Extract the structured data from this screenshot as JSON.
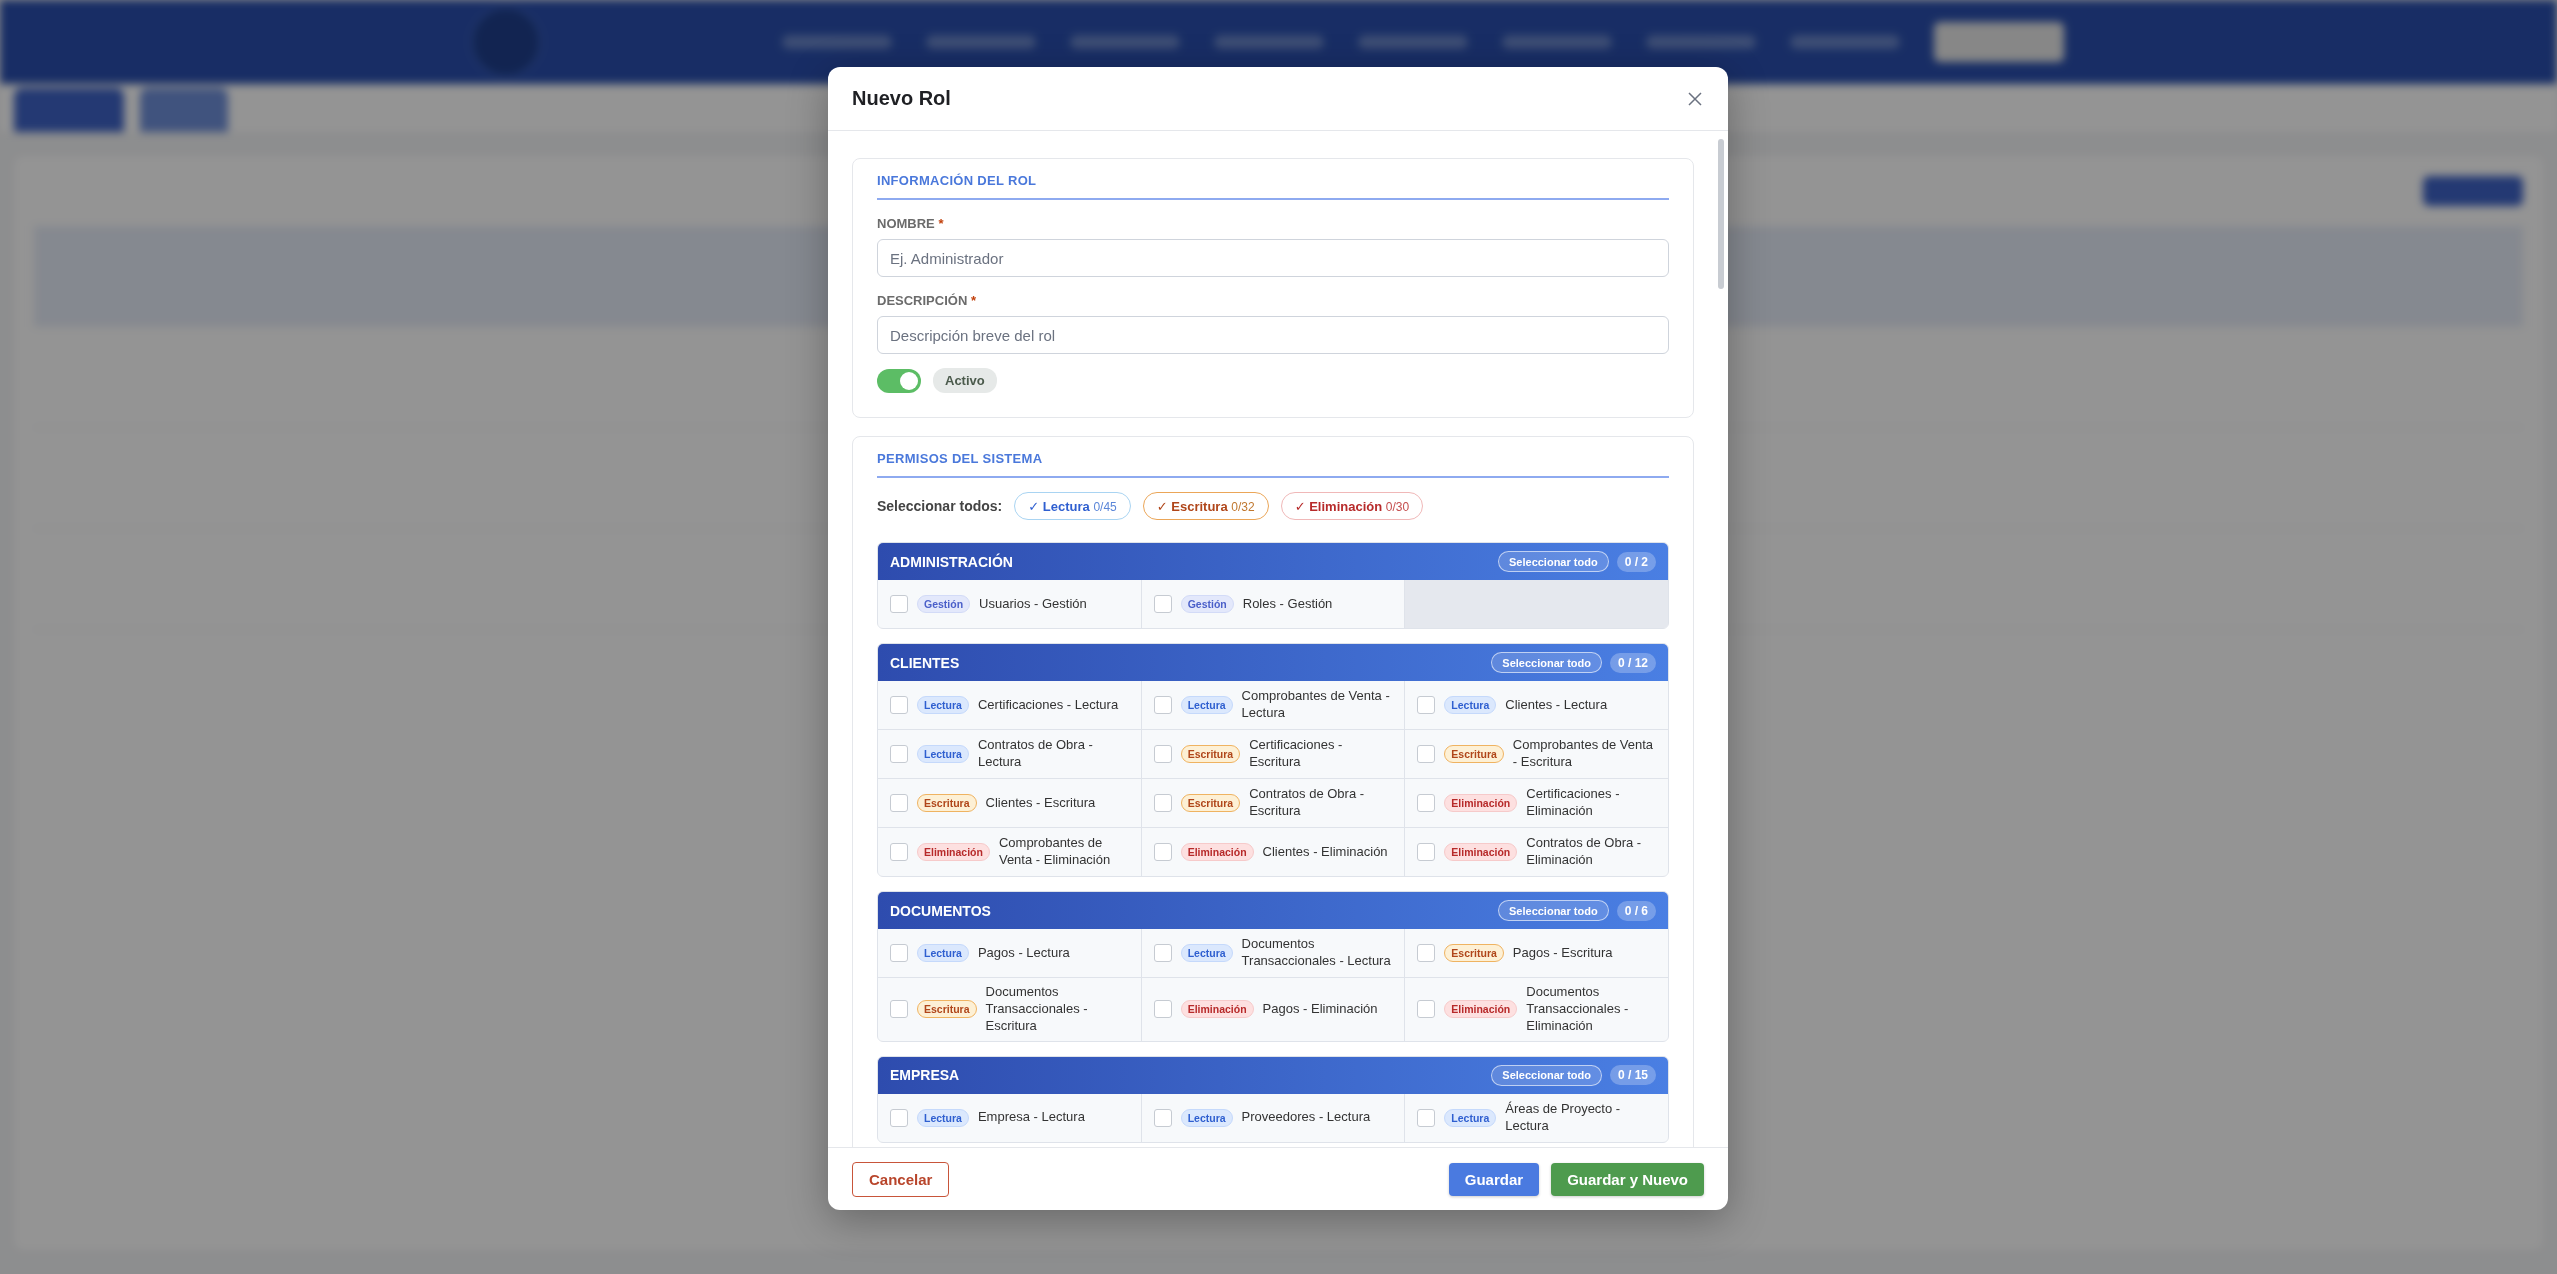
{
  "modal": {
    "title": "Nuevo Rol",
    "info_section": {
      "heading": "INFORMACIÓN DEL ROL",
      "fields": [
        {
          "label": "NOMBRE",
          "required_mark": "*",
          "placeholder": "Ej. Administrador"
        },
        {
          "label": "DESCRIPCIÓN",
          "required_mark": "*",
          "placeholder": "Descripción breve del rol"
        }
      ],
      "status": {
        "on": true,
        "label": "Activo"
      }
    },
    "permissions_section": {
      "heading": "PERMISOS DEL SISTEMA",
      "select_all_label": "Seleccionar todos:",
      "chips": [
        {
          "kind": "lectura",
          "check": "✓",
          "label": "Lectura",
          "count": "0/45"
        },
        {
          "kind": "escritura",
          "check": "✓",
          "label": "Escritura",
          "count": "0/32"
        },
        {
          "kind": "eliminacion",
          "check": "✓",
          "label": "Eliminación",
          "count": "0/30"
        }
      ],
      "groups": [
        {
          "title": "ADMINISTRACIÓN",
          "select_all": "Seleccionar todo",
          "count": "0 / 2",
          "items": [
            {
              "kind": "gestion",
              "badge": "Gestión",
              "label": "Usuarios - Gestión",
              "checked": false
            },
            {
              "kind": "gestion",
              "badge": "Gestión",
              "label": "Roles - Gestión",
              "checked": false
            }
          ]
        },
        {
          "title": "CLIENTES",
          "select_all": "Seleccionar todo",
          "count": "0 / 12",
          "items": [
            {
              "kind": "lectura",
              "badge": "Lectura",
              "label": "Certificaciones - Lectura",
              "checked": false
            },
            {
              "kind": "lectura",
              "badge": "Lectura",
              "label": "Comprobantes de Venta - Lectura",
              "checked": false
            },
            {
              "kind": "lectura",
              "badge": "Lectura",
              "label": "Clientes - Lectura",
              "checked": false
            },
            {
              "kind": "lectura",
              "badge": "Lectura",
              "label": "Contratos de Obra - Lectura",
              "checked": false
            },
            {
              "kind": "escritura",
              "badge": "Escritura",
              "label": "Certificaciones - Escritura",
              "checked": false
            },
            {
              "kind": "escritura",
              "badge": "Escritura",
              "label": "Comprobantes de Venta - Escritura",
              "checked": false
            },
            {
              "kind": "escritura",
              "badge": "Escritura",
              "label": "Clientes - Escritura",
              "checked": false
            },
            {
              "kind": "escritura",
              "badge": "Escritura",
              "label": "Contratos de Obra - Escritura",
              "checked": false
            },
            {
              "kind": "eliminacion",
              "badge": "Eliminación",
              "label": "Certificaciones - Eliminación",
              "checked": false
            },
            {
              "kind": "eliminacion",
              "badge": "Eliminación",
              "label": "Comprobantes de Venta - Eliminación",
              "checked": false
            },
            {
              "kind": "eliminacion",
              "badge": "Eliminación",
              "label": "Clientes - Eliminación",
              "checked": false
            },
            {
              "kind": "eliminacion",
              "badge": "Eliminación",
              "label": "Contratos de Obra - Eliminación",
              "checked": false
            }
          ]
        },
        {
          "title": "DOCUMENTOS",
          "select_all": "Seleccionar todo",
          "count": "0 / 6",
          "items": [
            {
              "kind": "lectura",
              "badge": "Lectura",
              "label": "Pagos - Lectura",
              "checked": false
            },
            {
              "kind": "lectura",
              "badge": "Lectura",
              "label": "Documentos Transaccionales - Lectura",
              "checked": false
            },
            {
              "kind": "escritura",
              "badge": "Escritura",
              "label": "Pagos - Escritura",
              "checked": false
            },
            {
              "kind": "escritura",
              "badge": "Escritura",
              "label": "Documentos Transaccionales - Escritura",
              "checked": false
            },
            {
              "kind": "eliminacion",
              "badge": "Eliminación",
              "label": "Pagos - Eliminación",
              "checked": false
            },
            {
              "kind": "eliminacion",
              "badge": "Eliminación",
              "label": "Documentos Transaccionales - Eliminación",
              "checked": false
            }
          ]
        },
        {
          "title": "EMPRESA",
          "select_all": "Seleccionar todo",
          "count": "0 / 15",
          "items": [
            {
              "kind": "lectura",
              "badge": "Lectura",
              "label": "Empresa - Lectura",
              "checked": false
            },
            {
              "kind": "lectura",
              "badge": "Lectura",
              "label": "Proveedores - Lectura",
              "checked": false
            },
            {
              "kind": "lectura",
              "badge": "Lectura",
              "label": "Áreas de Proyecto - Lectura",
              "checked": false
            }
          ]
        }
      ]
    },
    "footer": {
      "cancel": "Cancelar",
      "save": "Guardar",
      "save_new": "Guardar y Nuevo"
    }
  }
}
